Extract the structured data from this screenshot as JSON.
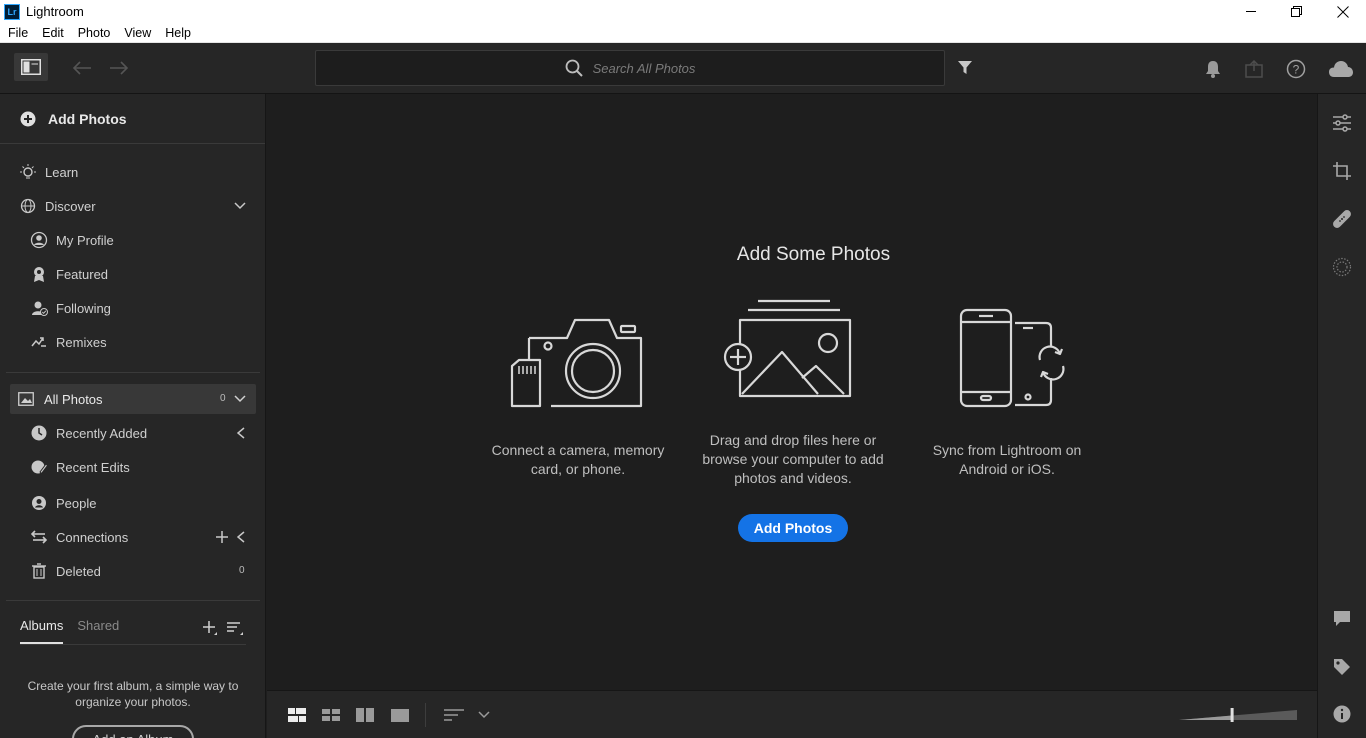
{
  "window": {
    "title": "Lightroom",
    "logo_text": "Lr",
    "controls": [
      "minimize-icon",
      "restore-icon",
      "close-icon"
    ]
  },
  "menu": [
    "File",
    "Edit",
    "Photo",
    "View",
    "Help"
  ],
  "toolbar": {
    "search_placeholder": "Search All Photos",
    "icons": [
      "panel-toggle-icon",
      "back-arrow-icon",
      "forward-arrow-icon",
      "search-icon",
      "filter-icon",
      "bell-icon",
      "share-icon",
      "help-icon",
      "cloud-icon"
    ]
  },
  "sidebar": {
    "add_photos": "Add Photos",
    "nav": [
      {
        "label": "Learn",
        "icon": "lightbulb-icon"
      },
      {
        "label": "Discover",
        "icon": "globe-icon"
      },
      {
        "label": "My Profile",
        "icon": "profile-icon"
      },
      {
        "label": "Featured",
        "icon": "award-icon"
      },
      {
        "label": "Following",
        "icon": "following-icon"
      },
      {
        "label": "Remixes",
        "icon": "remix-icon"
      }
    ],
    "library": {
      "all_photos": {
        "label": "All Photos",
        "count": "0"
      },
      "items": [
        {
          "label": "Recently Added",
          "icon": "clock-icon"
        },
        {
          "label": "Recent Edits",
          "icon": "edit-icon"
        },
        {
          "label": "People",
          "icon": "person-icon"
        },
        {
          "label": "Connections",
          "icon": "connections-icon"
        },
        {
          "label": "Deleted",
          "icon": "trash-icon",
          "count": "0"
        }
      ]
    },
    "albums": {
      "tabs": [
        "Albums",
        "Shared"
      ],
      "empty_message": "Create your first album, a simple way to organize your photos.",
      "add_album": "Add an Album"
    }
  },
  "main": {
    "title": "Add Some Photos",
    "options": [
      {
        "caption": "Connect a camera, memory card, or phone.",
        "icon": "camera-icon"
      },
      {
        "caption": "Drag and drop files here or browse your computer to add photos and videos.",
        "icon": "add-image-icon"
      },
      {
        "caption": "Sync from Lightroom on Android or iOS.",
        "icon": "mobile-sync-icon"
      }
    ],
    "cta": "Add Photos"
  },
  "bottombar": {
    "views": [
      "square-grid-icon",
      "photo-grid-icon",
      "detail-view-icon",
      "single-view-icon"
    ],
    "sort_icon": "sort-icon",
    "thumb_size_level": 0.45
  },
  "rightrail": [
    "edit-sliders-icon",
    "crop-icon",
    "healing-icon",
    "masking-icon",
    "comment-icon",
    "tag-icon",
    "info-icon"
  ],
  "colors": {
    "accent": "#1473e6",
    "panel": "#262626",
    "canvas": "#1e1e1e"
  }
}
